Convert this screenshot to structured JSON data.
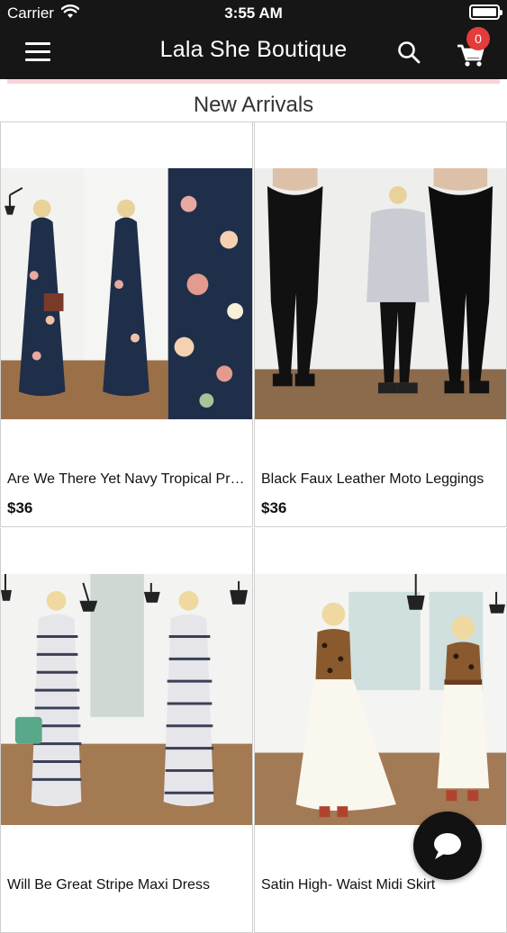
{
  "status_bar": {
    "carrier": "Carrier",
    "time": "3:55 AM",
    "battery_level_percent": 100
  },
  "header": {
    "title": "Lala She Boutique",
    "menu_icon": "hamburger-menu-icon",
    "search_icon": "search-icon",
    "cart_icon": "shopping-cart-icon",
    "cart_count": "0"
  },
  "section": {
    "title": "New Arrivals"
  },
  "products": [
    {
      "name": "Are We There Yet Navy Tropical Print Maxi Dress",
      "price": "$36",
      "image": "navy-floral-maxi-dress-photo"
    },
    {
      "name": "Black Faux Leather Moto Leggings",
      "price": "$36",
      "image": "black-moto-leggings-photo"
    },
    {
      "name": "Will Be Great Stripe Maxi Dress",
      "price": "",
      "image": "stripe-maxi-dress-photo"
    },
    {
      "name": "Satin High- Waist Midi Skirt",
      "price": "",
      "image": "white-midi-skirt-photo"
    }
  ],
  "chat": {
    "icon": "chat-bubble-icon"
  },
  "colors": {
    "header_bg": "#161616",
    "badge": "#e43b3b",
    "accent_strip": "#f8d4d8"
  }
}
